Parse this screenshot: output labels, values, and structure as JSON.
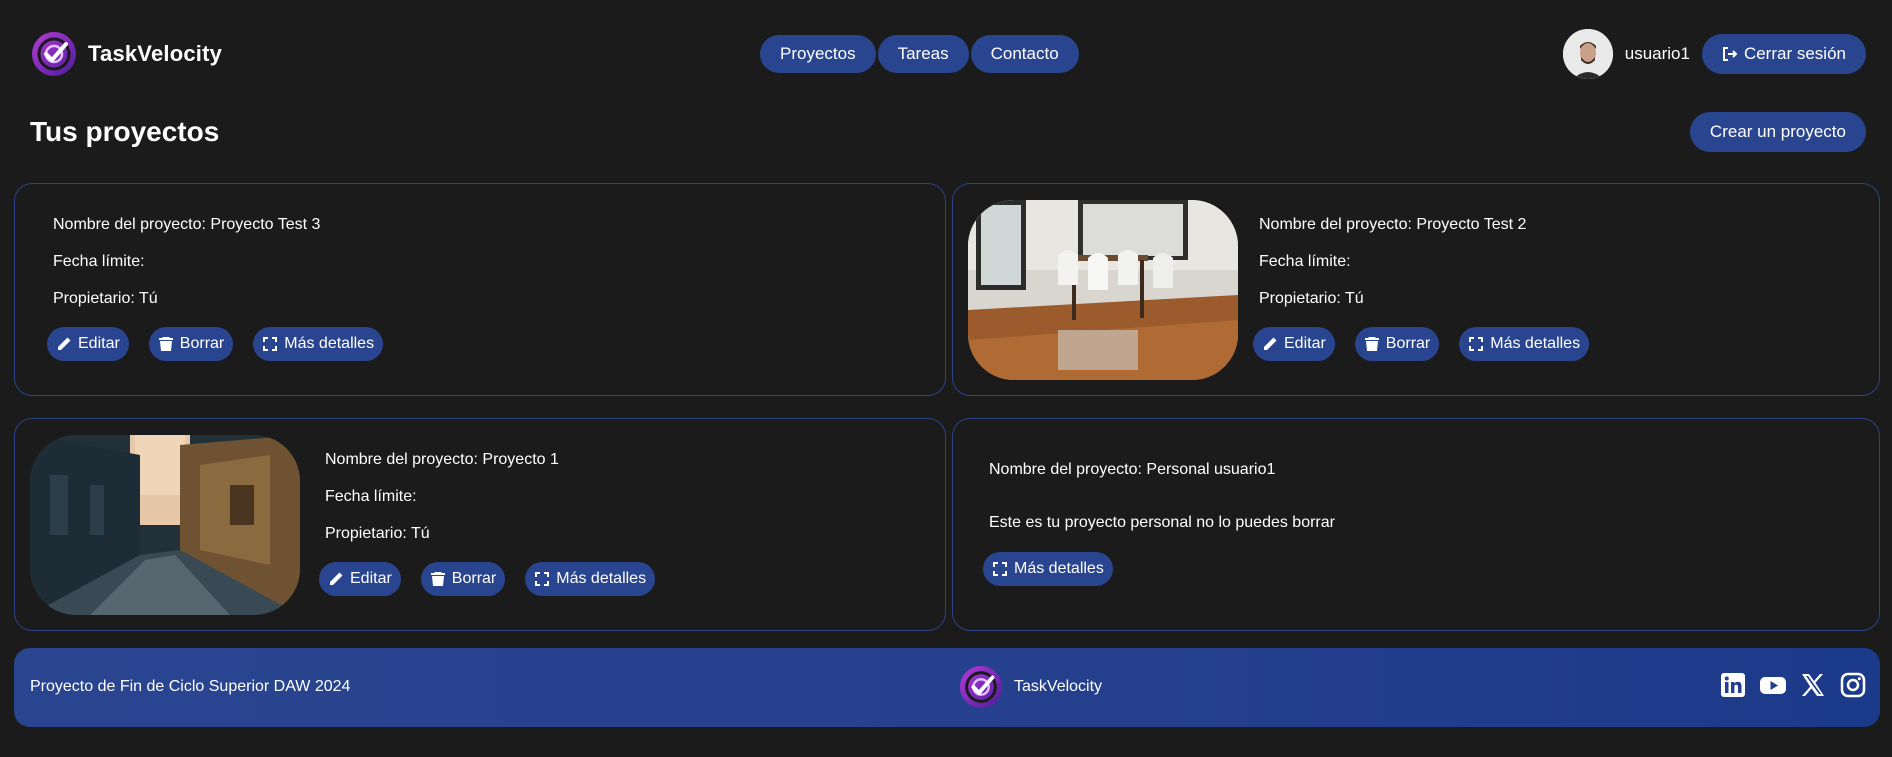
{
  "header": {
    "brand": "TaskVelocity",
    "nav": [
      "Proyectos",
      "Tareas",
      "Contacto"
    ],
    "username": "usuario1",
    "logout_label": "Cerrar sesión"
  },
  "page": {
    "title": "Tus proyectos",
    "create_label": "Crear un proyecto"
  },
  "projects": [
    {
      "name_line": "Nombre del proyecto: Proyecto Test 3",
      "deadline_line": "Fecha límite:",
      "owner_line": "Propietario: Tú",
      "edit": "Editar",
      "delete": "Borrar",
      "details": "Más detalles"
    },
    {
      "name_line": "Nombre del proyecto: Proyecto Test 2",
      "deadline_line": "Fecha límite:",
      "owner_line": "Propietario: Tú",
      "edit": "Editar",
      "delete": "Borrar",
      "details": "Más detalles"
    },
    {
      "name_line": "Nombre del proyecto: Proyecto 1",
      "deadline_line": "Fecha límite:",
      "owner_line": "Propietario: Tú",
      "edit": "Editar",
      "delete": "Borrar",
      "details": "Más detalles"
    },
    {
      "name_line": "Nombre del proyecto: Personal usuario1",
      "note": "Este es tu proyecto personal no lo puedes borrar",
      "details": "Más detalles"
    }
  ],
  "footer": {
    "text": "Proyecto de Fin de Ciclo Superior DAW 2024",
    "brand": "TaskVelocity",
    "socials": [
      "linkedin-icon",
      "youtube-icon",
      "x-icon",
      "instagram-icon"
    ]
  },
  "colors": {
    "background": "#1b1b1b",
    "accent": "#2a4590",
    "card_border": "#2d4387"
  }
}
